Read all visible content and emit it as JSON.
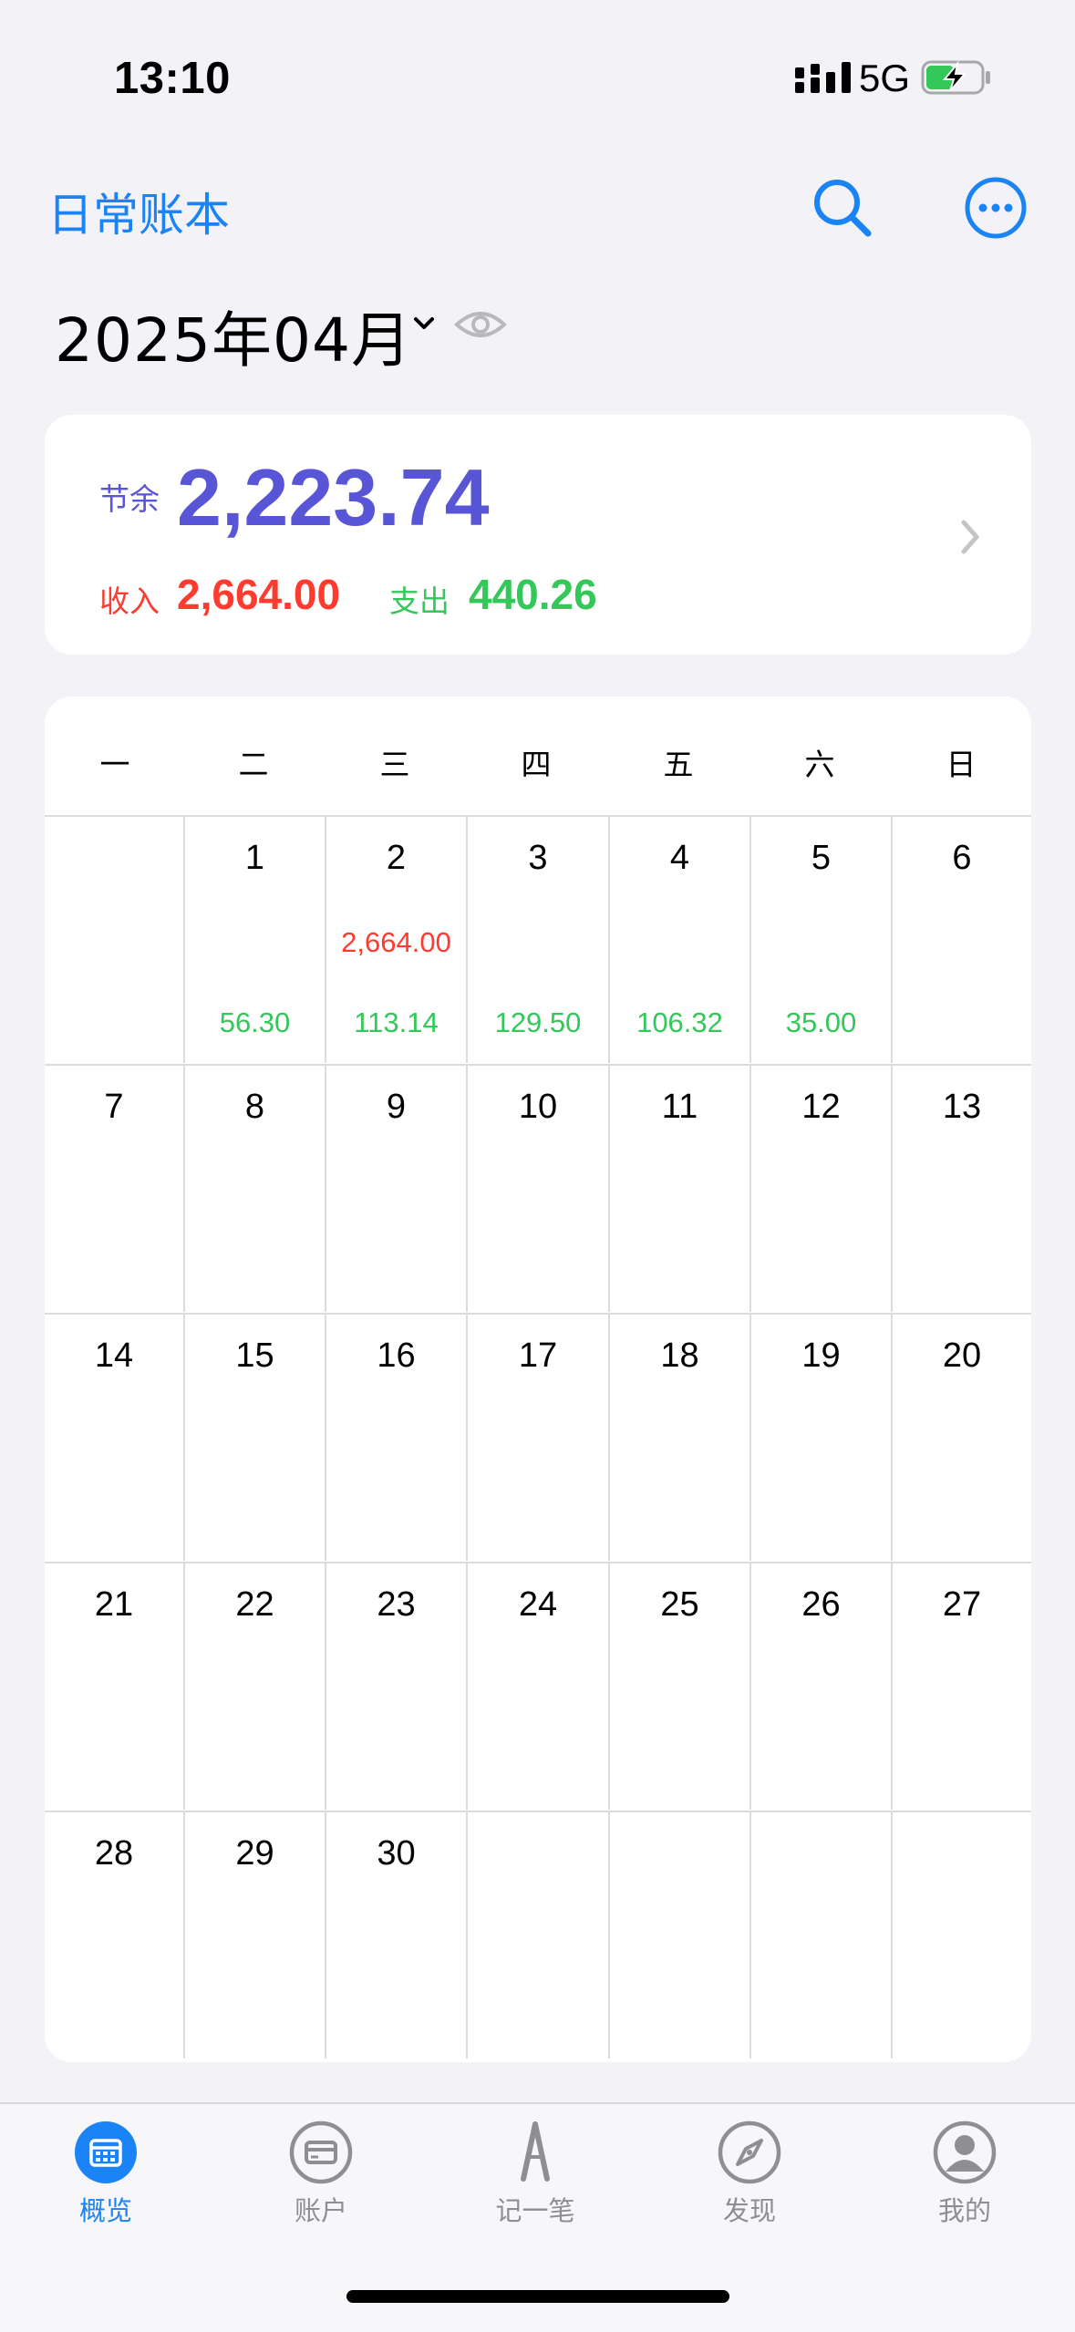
{
  "status_bar": {
    "time": "13:10",
    "network": "5G"
  },
  "header": {
    "book_title": "日常账本",
    "month": "2025年04月"
  },
  "summary": {
    "balance_label": "节余",
    "balance_value": "2,223.74",
    "income_label": "收入",
    "income_value": "2,664.00",
    "expense_label": "支出",
    "expense_value": "440.26"
  },
  "calendar": {
    "weekdays": [
      "一",
      "二",
      "三",
      "四",
      "五",
      "六",
      "日"
    ],
    "leading_blanks": 1,
    "days_in_month": 30,
    "income_by_day": {
      "2": "2,664.00"
    },
    "expense_by_day": {
      "1": "56.30",
      "2": "113.14",
      "3": "129.50",
      "4": "106.32",
      "5": "35.00"
    }
  },
  "tabs": [
    {
      "label": "概览",
      "icon": "calendar-icon",
      "active": true
    },
    {
      "label": "账户",
      "icon": "card-icon",
      "active": false
    },
    {
      "label": "记一笔",
      "icon": "pen-icon",
      "active": false
    },
    {
      "label": "发现",
      "icon": "compass-icon",
      "active": false
    },
    {
      "label": "我的",
      "icon": "profile-icon",
      "active": false
    }
  ],
  "colors": {
    "accent": "#1A83F5",
    "balance": "#5856D6",
    "income": "#FF3B30",
    "expense": "#34C759"
  }
}
